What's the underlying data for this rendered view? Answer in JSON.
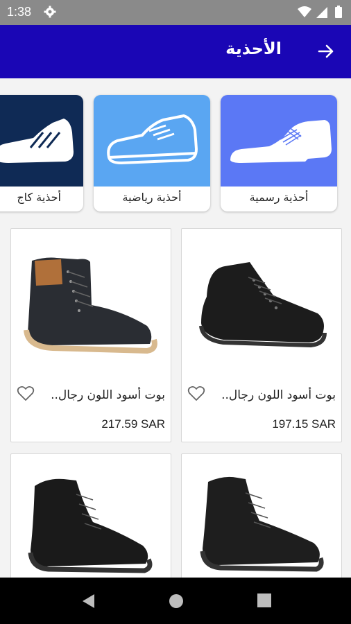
{
  "status_bar": {
    "time": "1:38"
  },
  "app_bar": {
    "title": "الأحذية"
  },
  "categories": [
    {
      "label": "أحذية رسمية",
      "bg": "#5b78f5"
    },
    {
      "label": "أحذية رياضية",
      "bg": "#5aa6f2"
    },
    {
      "label": "أحذية كاج",
      "bg": "#0f2a55"
    }
  ],
  "products": [
    {
      "name": "بوت أسود اللون رجال..",
      "price": "197.15 SAR"
    },
    {
      "name": "بوت أسود اللون رجال..",
      "price": "217.59 SAR"
    },
    {
      "name": "",
      "price": ""
    },
    {
      "name": "",
      "price": ""
    }
  ],
  "colors": {
    "app_bar": "#1a06b5",
    "status_bar": "#8a8a8a",
    "nav_bar": "#000000"
  }
}
